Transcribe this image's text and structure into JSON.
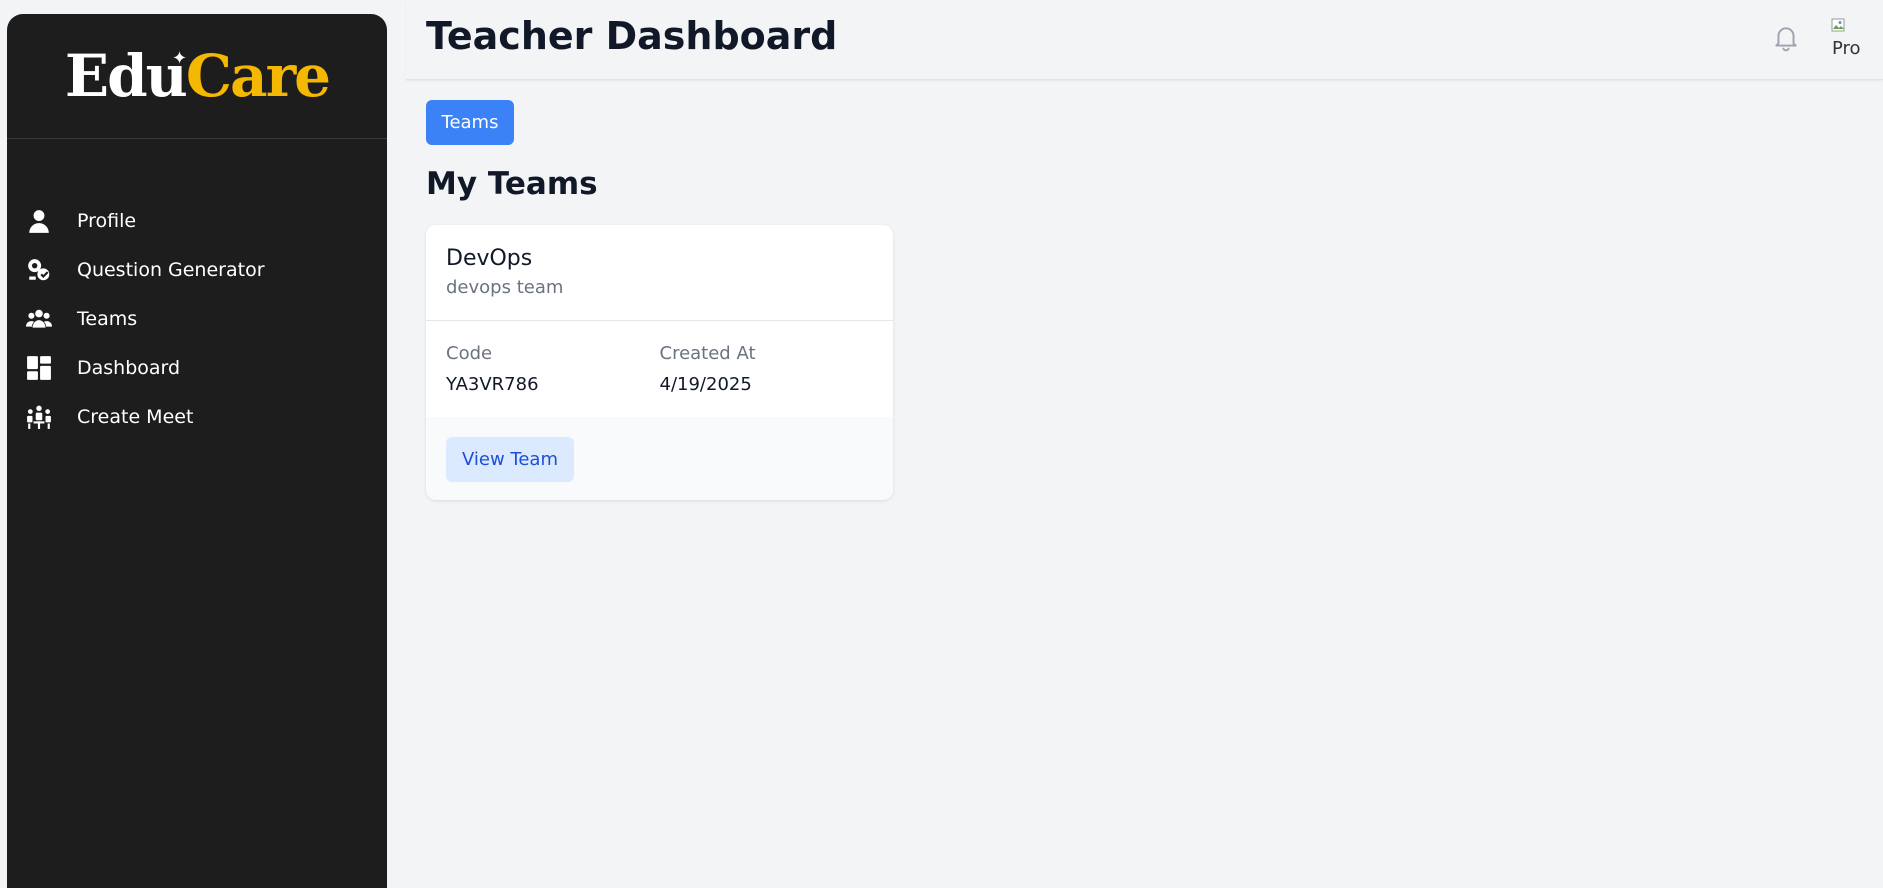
{
  "brand": {
    "part1": "Edu",
    "part2": "Care",
    "accent_color": "#f5b800"
  },
  "sidebar": {
    "items": [
      {
        "label": "Profile",
        "icon": "user-icon"
      },
      {
        "label": "Question Generator",
        "icon": "question-generator-icon"
      },
      {
        "label": "Teams",
        "icon": "users-group-icon"
      },
      {
        "label": "Dashboard",
        "icon": "dashboard-grid-icon"
      },
      {
        "label": "Create Meet",
        "icon": "meeting-icon"
      }
    ]
  },
  "header": {
    "title": "Teacher Dashboard",
    "notification_icon": "bell-icon",
    "avatar_alt": "Pro"
  },
  "main": {
    "tab_label": "Teams",
    "section_title": "My Teams",
    "teams": [
      {
        "name": "DevOps",
        "description": "devops team",
        "code_label": "Code",
        "code": "YA3VR786",
        "created_label": "Created At",
        "created_at": "4/19/2025",
        "action_label": "View Team"
      }
    ]
  },
  "colors": {
    "sidebar_bg": "#1d1d1d",
    "primary": "#3b82f6",
    "page_bg": "#f3f4f6"
  }
}
